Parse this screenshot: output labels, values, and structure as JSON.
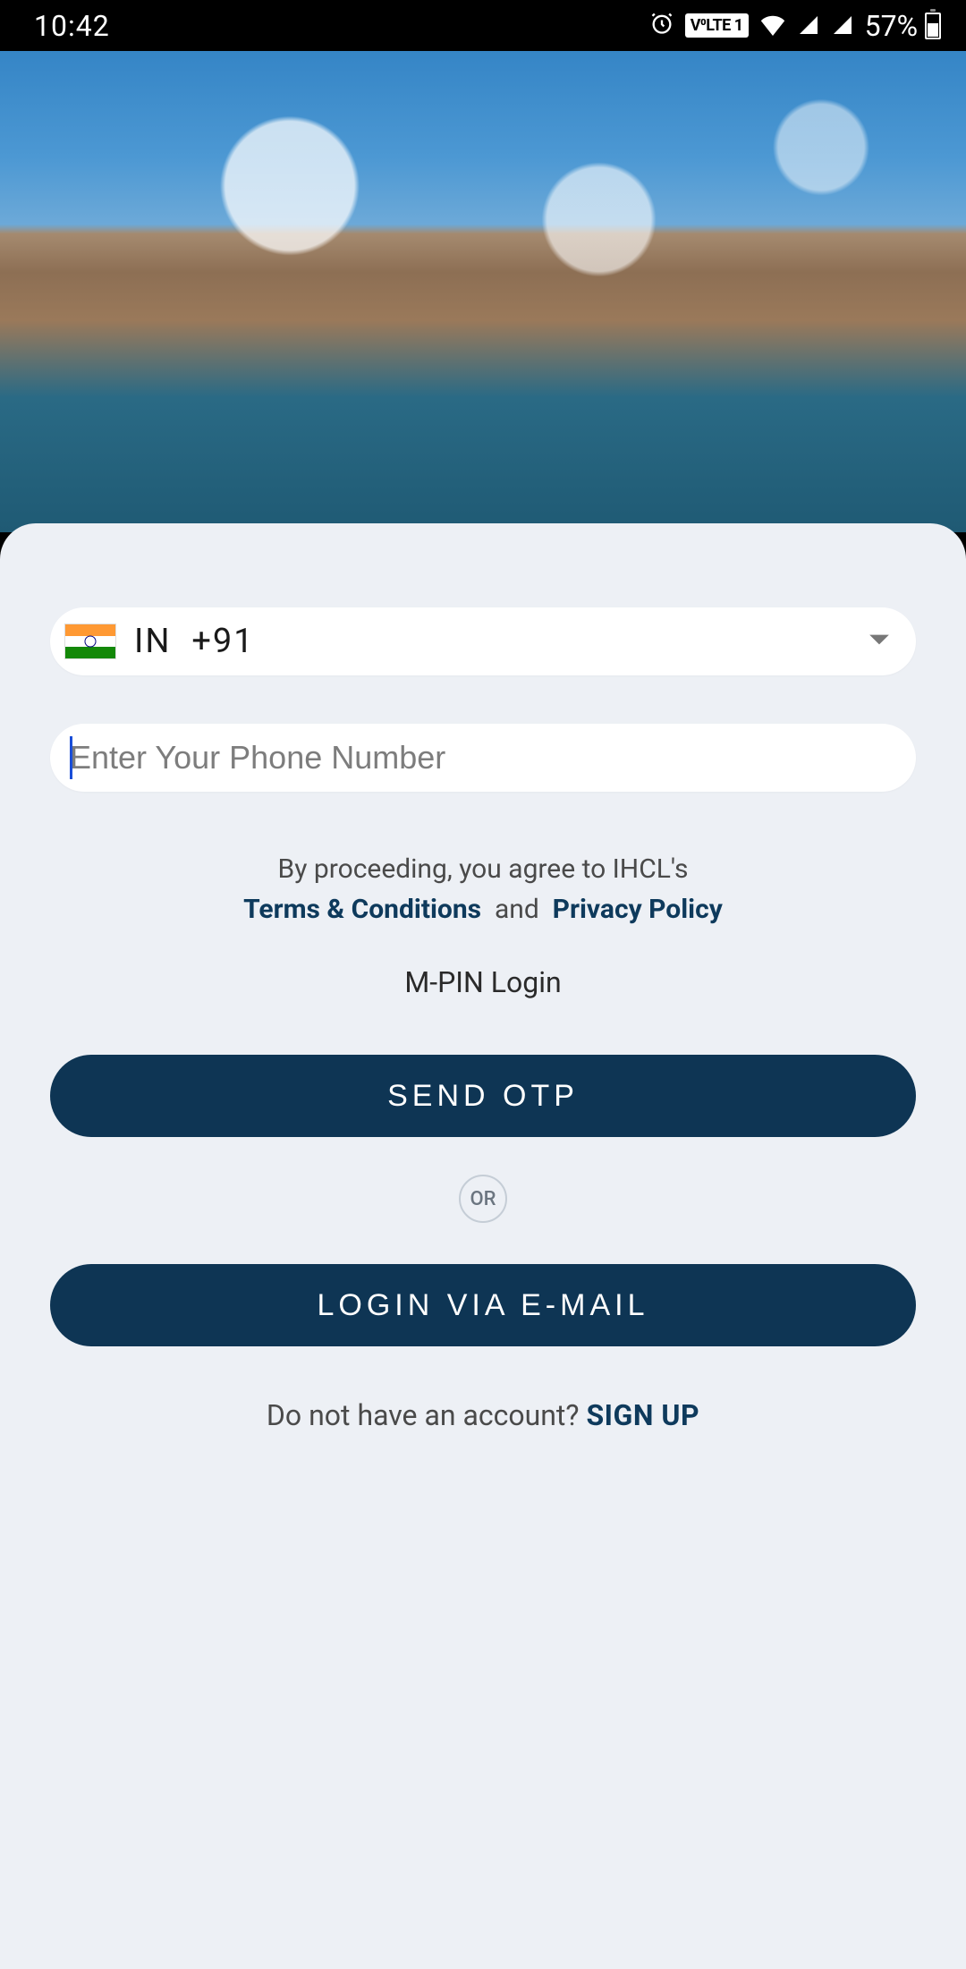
{
  "status_bar": {
    "time": "10:42",
    "volte": "V⁰LTE 1",
    "battery_pct": "57%"
  },
  "login": {
    "country_code_iso": "IN",
    "country_dial": "+91",
    "phone_placeholder": "Enter Your Phone Number",
    "legal_prefix": "By proceeding, you agree to IHCL's",
    "terms_label": "Terms & Conditions",
    "and": "and",
    "privacy_label": "Privacy Policy",
    "mpin_label": "M-PIN Login",
    "send_otp": "SEND OTP",
    "or": "OR",
    "login_email": "LOGIN VIA E-MAIL",
    "signup_prompt": "Do not have an account?",
    "signup_cta": "SIGN UP"
  }
}
